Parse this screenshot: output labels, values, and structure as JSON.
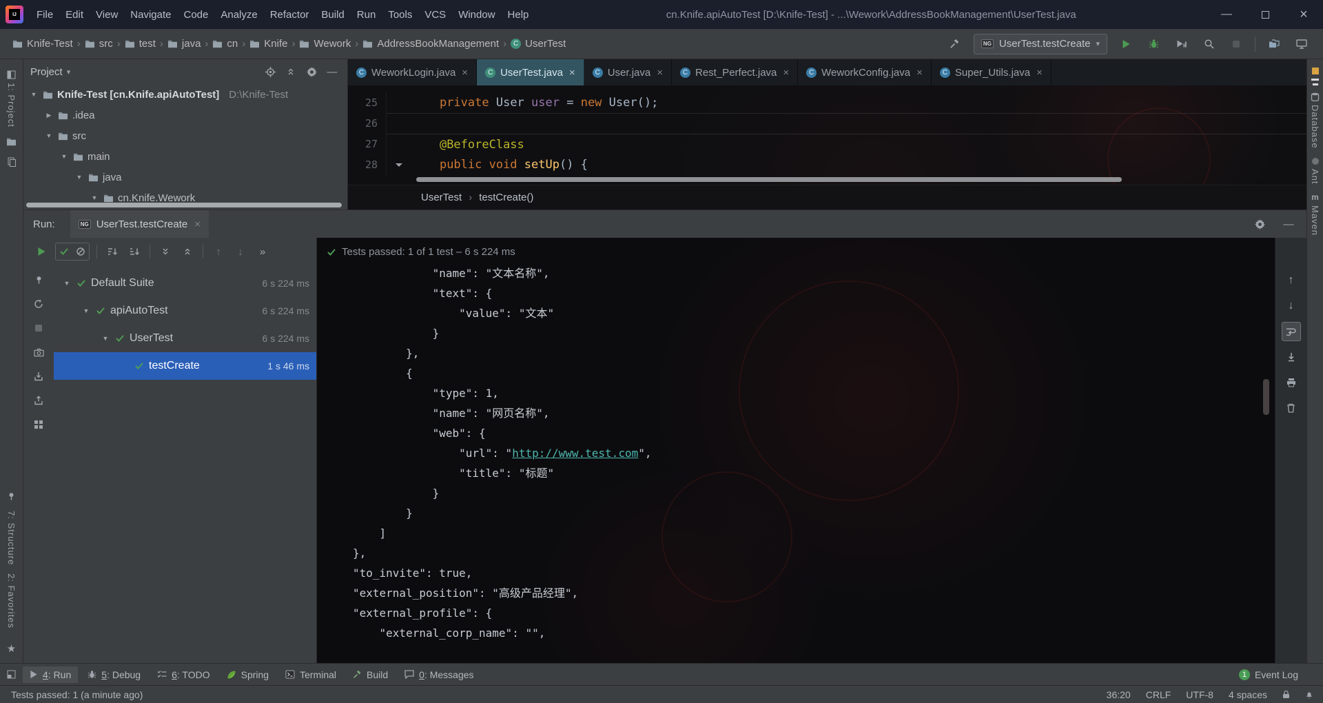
{
  "icons": {
    "close": "×",
    "dropdown": "▾",
    "chevron": "›",
    "tree_expanded": "▼",
    "tree_collapsed": "▶",
    "up": "↑",
    "down": "↓",
    "more": "»",
    "minimize": "—",
    "star": "★"
  },
  "titlebar": {
    "menus": [
      "File",
      "Edit",
      "View",
      "Navigate",
      "Code",
      "Analyze",
      "Refactor",
      "Build",
      "Run",
      "Tools",
      "VCS",
      "Window",
      "Help"
    ],
    "title": "cn.Knife.apiAutoTest [D:\\Knife-Test] - ...\\Wework\\AddressBookManagement\\UserTest.java"
  },
  "navbar": {
    "breadcrumbs": [
      {
        "label": "Knife-Test",
        "icon": "folder"
      },
      {
        "label": "src",
        "icon": "folder"
      },
      {
        "label": "test",
        "icon": "folder"
      },
      {
        "label": "java",
        "icon": "folder"
      },
      {
        "label": "cn",
        "icon": "folder"
      },
      {
        "label": "Knife",
        "icon": "folder"
      },
      {
        "label": "Wework",
        "icon": "folder"
      },
      {
        "label": "AddressBookManagement",
        "icon": "folder"
      },
      {
        "label": "UserTest",
        "icon": "class"
      }
    ],
    "run_config": {
      "icon": "NG",
      "label": "UserTest.testCreate"
    }
  },
  "left_stripe": {
    "project": "1: Project",
    "structure": "7: Structure",
    "favorites": "2: Favorites"
  },
  "right_stripe": {
    "database": "Database",
    "ant": "Ant",
    "maven": "Maven",
    "maven_icon": "m"
  },
  "project_panel": {
    "title": "Project",
    "tree": [
      {
        "name": "Knife-Test [cn.Knife.apiAutoTest]",
        "path": "D:\\Knife-Test",
        "depth": 0,
        "state": "expanded",
        "bold": true
      },
      {
        "name": ".idea",
        "depth": 1,
        "state": "collapsed",
        "bold": false
      },
      {
        "name": "src",
        "depth": 1,
        "state": "expanded",
        "bold": false
      },
      {
        "name": "main",
        "depth": 2,
        "state": "expanded",
        "bold": false
      },
      {
        "name": "java",
        "depth": 3,
        "state": "expanded",
        "bold": false
      },
      {
        "name": "cn.Knife.Wework",
        "depth": 4,
        "state": "expanded",
        "bold": false
      }
    ]
  },
  "editor": {
    "tabs": [
      {
        "label": "WeworkLogin.java",
        "active": false
      },
      {
        "label": "UserTest.java",
        "active": true
      },
      {
        "label": "User.java",
        "active": false
      },
      {
        "label": "Rest_Perfect.java",
        "active": false
      },
      {
        "label": "WeworkConfig.java",
        "active": false
      },
      {
        "label": "Super_Utils.java",
        "active": false
      }
    ],
    "lines": [
      {
        "num": "25",
        "sep": false,
        "marker": false,
        "segments": [
          {
            "t": "    ",
            "c": "pl"
          },
          {
            "t": "private ",
            "c": "kw"
          },
          {
            "t": "User ",
            "c": "pl"
          },
          {
            "t": "user ",
            "c": "fld"
          },
          {
            "t": "= ",
            "c": "pl"
          },
          {
            "t": "new ",
            "c": "kw"
          },
          {
            "t": "User();",
            "c": "pl"
          }
        ]
      },
      {
        "num": "26",
        "sep": true,
        "marker": false,
        "segments": []
      },
      {
        "num": "27",
        "sep": true,
        "marker": false,
        "segments": [
          {
            "t": "    ",
            "c": "pl"
          },
          {
            "t": "@BeforeClass",
            "c": "ann"
          }
        ]
      },
      {
        "num": "28",
        "sep": false,
        "marker": true,
        "segments": [
          {
            "t": "    ",
            "c": "pl"
          },
          {
            "t": "public void ",
            "c": "kw"
          },
          {
            "t": "setUp",
            "c": "mth"
          },
          {
            "t": "() {",
            "c": "pl"
          }
        ]
      }
    ],
    "breadcrumb": [
      "UserTest",
      "testCreate()"
    ]
  },
  "run_panel": {
    "label": "Run:",
    "tab": {
      "icon": "NG",
      "label": "UserTest.testCreate"
    },
    "status": "Tests passed: 1 of 1 test – 6 s 224 ms",
    "tree": [
      {
        "name": "Default Suite",
        "time": "6 s 224 ms",
        "depth": 0,
        "arrow": true,
        "selected": false
      },
      {
        "name": "apiAutoTest",
        "time": "6 s 224 ms",
        "depth": 1,
        "arrow": true,
        "selected": false
      },
      {
        "name": "UserTest",
        "time": "6 s 224 ms",
        "depth": 2,
        "arrow": true,
        "selected": false
      },
      {
        "name": "testCreate",
        "time": "1 s 46 ms",
        "depth": 3,
        "arrow": false,
        "selected": true
      }
    ],
    "console": [
      {
        "indent": 3,
        "parts": [
          {
            "t": "\"name\": \"文本名称\","
          }
        ]
      },
      {
        "indent": 3,
        "parts": [
          {
            "t": "\"text\": {"
          }
        ]
      },
      {
        "indent": 4,
        "parts": [
          {
            "t": "\"value\": \"文本\""
          }
        ]
      },
      {
        "indent": 3,
        "parts": [
          {
            "t": "}"
          }
        ]
      },
      {
        "indent": 2,
        "parts": [
          {
            "t": "},"
          }
        ]
      },
      {
        "indent": 2,
        "parts": [
          {
            "t": "{"
          }
        ]
      },
      {
        "indent": 3,
        "parts": [
          {
            "t": "\"type\": 1,"
          }
        ]
      },
      {
        "indent": 3,
        "parts": [
          {
            "t": "\"name\": \"网页名称\","
          }
        ]
      },
      {
        "indent": 3,
        "parts": [
          {
            "t": "\"web\": {"
          }
        ]
      },
      {
        "indent": 4,
        "parts": [
          {
            "t": "\"url\": \""
          },
          {
            "t": "http://www.test.com",
            "link": true
          },
          {
            "t": "\","
          }
        ]
      },
      {
        "indent": 4,
        "parts": [
          {
            "t": "\"title\": \"标题\""
          }
        ]
      },
      {
        "indent": 3,
        "parts": [
          {
            "t": "}"
          }
        ]
      },
      {
        "indent": 2,
        "parts": [
          {
            "t": "}"
          }
        ]
      },
      {
        "indent": 1,
        "parts": [
          {
            "t": "]"
          }
        ]
      },
      {
        "indent": 0,
        "parts": [
          {
            "t": "},"
          }
        ]
      },
      {
        "indent": 0,
        "parts": [
          {
            "t": "\"to_invite\": true,"
          }
        ]
      },
      {
        "indent": 0,
        "parts": [
          {
            "t": "\"external_position\": \"高级产品经理\","
          }
        ]
      },
      {
        "indent": 0,
        "parts": [
          {
            "t": "\"external_profile\": {"
          }
        ]
      },
      {
        "indent": 1,
        "parts": [
          {
            "t": "\"external_corp_name\": \"\","
          }
        ]
      }
    ]
  },
  "bottom_bar": {
    "items": [
      {
        "label": "4: Run",
        "icon": "run",
        "active": true
      },
      {
        "label": "5: Debug",
        "icon": "debug",
        "active": false
      },
      {
        "label": "6: TODO",
        "icon": "todo",
        "active": false
      },
      {
        "label": "Spring",
        "icon": "spring",
        "active": false
      },
      {
        "label": "Terminal",
        "icon": "terminal",
        "active": false
      },
      {
        "label": "Build",
        "icon": "build",
        "active": false
      },
      {
        "label": "0: Messages",
        "icon": "messages",
        "active": false
      }
    ],
    "event_log": {
      "label": "Event Log",
      "count": "1"
    }
  },
  "statusbar": {
    "message": "Tests passed: 1 (a minute ago)",
    "caret": "36:20",
    "line_sep": "CRLF",
    "encoding": "UTF-8",
    "indent": "4 spaces"
  },
  "colors": {
    "selection": "#2a5fb8",
    "pass_green": "#4d9b53",
    "keyword": "#cc7832",
    "annotation": "#bbb529",
    "method": "#ffc66d",
    "field": "#9876aa",
    "console_link": "#4db6ac",
    "warning_stripe": "#d9a343",
    "spring_leaf": "#6db33f"
  }
}
